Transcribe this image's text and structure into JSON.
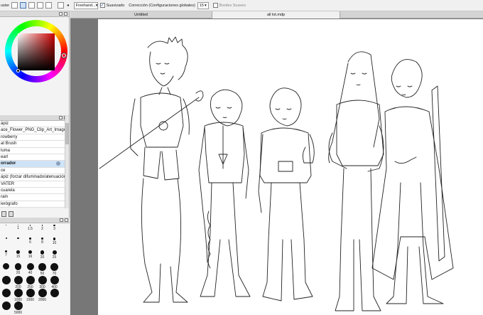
{
  "toolbar": {
    "leading_text": "uster",
    "stabilizer_mode": "Freehand...",
    "smoothing_label": "Suavizado",
    "smoothing_checked": true,
    "correction_label": "Corrección (Configuraciones globales)",
    "correction_value": "15",
    "soft_edges_label": "Bordes Suaves",
    "soft_edges_checked": false
  },
  "tabs": [
    {
      "label": "Untitled",
      "active": false
    },
    {
      "label": "all lot.mdp",
      "active": true
    }
  ],
  "color": {
    "current": "#000000",
    "hue": "#ff0000"
  },
  "tools": [
    {
      "label": "ápiz",
      "selected": false
    },
    {
      "label": "ace_Flower_PNG_Clip_Art_Image",
      "selected": false
    },
    {
      "label": "rowberry",
      "selected": false
    },
    {
      "label": "at Brush",
      "selected": false
    },
    {
      "label": "luma",
      "selected": false
    },
    {
      "label": "earl",
      "selected": false
    },
    {
      "label": "orrador",
      "selected": true
    },
    {
      "label": "ce",
      "selected": false
    },
    {
      "label": "ápiz (forzar difuminado/atenuación",
      "selected": false
    },
    {
      "label": "VATER",
      "selected": false
    },
    {
      "label": "cuarela",
      "selected": false
    },
    {
      "label": "rain",
      "selected": false
    },
    {
      "label": "ierógrafo",
      "selected": false
    }
  ],
  "brush_sizes": [
    {
      "label": "",
      "size": 1
    },
    {
      "label": "1",
      "size": 1.2
    },
    {
      "label": "1.5",
      "size": 1.5
    },
    {
      "label": "2",
      "size": 1.8
    },
    {
      "label": "3",
      "size": 2.2
    },
    {
      "label": "",
      "size": 2
    },
    {
      "label": "",
      "size": 2.4
    },
    {
      "label": "6",
      "size": 2.8
    },
    {
      "label": "8",
      "size": 3.2
    },
    {
      "label": "10",
      "size": 3.8
    },
    {
      "label": "7",
      "size": 3
    },
    {
      "label": "15",
      "size": 4.5
    },
    {
      "label": "16",
      "size": 4.8
    },
    {
      "label": "20",
      "size": 5.5
    },
    {
      "label": "25",
      "size": 6
    },
    {
      "label": "",
      "size": 9
    },
    {
      "label": "20",
      "size": 9.5
    },
    {
      "label": "40",
      "size": 10
    },
    {
      "label": "50",
      "size": 10.5
    },
    {
      "label": "70",
      "size": 11
    },
    {
      "label": "",
      "size": 12
    },
    {
      "label": "200",
      "size": 12
    },
    {
      "label": "250",
      "size": 12
    },
    {
      "label": "300",
      "size": 12
    },
    {
      "label": "400",
      "size": 12
    },
    {
      "label": "",
      "size": 12
    },
    {
      "label": "1000",
      "size": 12
    },
    {
      "label": "1500",
      "size": 12
    },
    {
      "label": "2000",
      "size": 12
    },
    {
      "label": "",
      "size": 12
    },
    {
      "label": "",
      "size": 12
    },
    {
      "label": "5000",
      "size": 12
    }
  ]
}
